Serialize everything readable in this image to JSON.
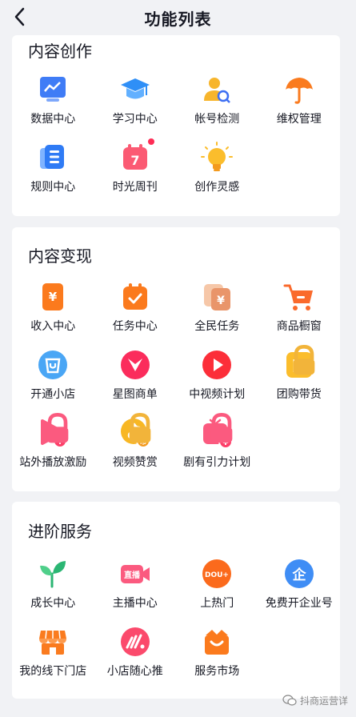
{
  "header": {
    "title": "功能列表"
  },
  "sections": [
    {
      "title": "内容创作",
      "items": [
        {
          "label": "数据中心",
          "icon": "data-center-icon"
        },
        {
          "label": "学习中心",
          "icon": "graduation-cap-icon"
        },
        {
          "label": "帐号检测",
          "icon": "account-check-icon"
        },
        {
          "label": "维权管理",
          "icon": "umbrella-icon"
        },
        {
          "label": "规则中心",
          "icon": "rules-doc-icon"
        },
        {
          "label": "时光周刊",
          "icon": "calendar-7-icon",
          "badge": "dot"
        },
        {
          "label": "创作灵感",
          "icon": "lightbulb-icon"
        }
      ]
    },
    {
      "title": "内容变现",
      "items": [
        {
          "label": "收入中心",
          "icon": "yuan-phone-icon"
        },
        {
          "label": "任务中心",
          "icon": "task-check-icon"
        },
        {
          "label": "全民任务",
          "icon": "yuan-cards-icon"
        },
        {
          "label": "商品橱窗",
          "icon": "shopping-cart-icon"
        },
        {
          "label": "开通小店",
          "icon": "shop-bag-icon"
        },
        {
          "label": "星图商单",
          "icon": "star-map-icon"
        },
        {
          "label": "中视频计划",
          "icon": "play-circle-icon"
        },
        {
          "label": "团购带货",
          "icon": "group-buy-icon",
          "locked": true
        },
        {
          "label": "站外播放激励",
          "icon": "play-yuan-icon",
          "locked": true
        },
        {
          "label": "视频赞赏",
          "icon": "tiktok-coin-icon",
          "locked": true
        },
        {
          "label": "剧有引力计划",
          "icon": "tv-yuan-icon",
          "locked": true
        }
      ]
    },
    {
      "title": "进阶服务",
      "items": [
        {
          "label": "成长中心",
          "icon": "sprout-icon"
        },
        {
          "label": "主播中心",
          "icon": "live-camera-icon",
          "icon_text": "直播"
        },
        {
          "label": "上热门",
          "icon": "dou-plus-icon",
          "icon_text": "DOU+"
        },
        {
          "label": "免费开企业号",
          "icon": "enterprise-icon",
          "icon_text": "企"
        },
        {
          "label": "我的线下门店",
          "icon": "storefront-icon"
        },
        {
          "label": "小店随心推",
          "icon": "shop-boost-icon"
        },
        {
          "label": "服务市场",
          "icon": "service-market-icon"
        }
      ]
    }
  ],
  "watermark": {
    "text": "抖商运营详",
    "icon": "wechat-icon"
  }
}
